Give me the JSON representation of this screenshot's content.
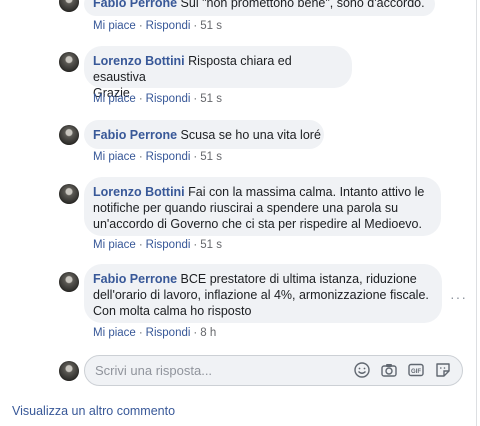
{
  "comments": [
    {
      "author": "Fabio Perrone",
      "text": "Sul \"non promettono bene\", sono d'accordo.",
      "like": "Mi piace",
      "reply": "Rispondi",
      "time": "51 s"
    },
    {
      "author": "Lorenzo Bottini",
      "text_line1": "Risposta chiara ed esaustiva",
      "text_line2": "Grazie",
      "like": "Mi piace",
      "reply": "Rispondi",
      "time": "51 s"
    },
    {
      "author": "Fabio Perrone",
      "text": "Scusa se ho una vita loré",
      "like": "Mi piace",
      "reply": "Rispondi",
      "time": "51 s"
    },
    {
      "author": "Lorenzo Bottini",
      "text_line1": "Fai con la massima calma. Intanto attivo le",
      "text_line2": "notifiche per quando riuscirai a spendere una parola su",
      "text_line3": "un'accordo di Governo che ci sta per rispedire al Medioevo.",
      "like": "Mi piace",
      "reply": "Rispondi",
      "time": "51 s"
    },
    {
      "author": "Fabio Perrone",
      "text_line1": "BCE prestatore di ultima istanza, riduzione",
      "text_line2": "dell'orario di lavoro, inflazione al 4%, armonizzazione fiscale.",
      "text_line3": "Con molta calma ho risposto",
      "like": "Mi piace",
      "reply": "Rispondi",
      "time": "8 h"
    }
  ],
  "reply_box": {
    "placeholder": "Scrivi una risposta..."
  },
  "more_options": "···",
  "view_more": "Visualizza un altro commento",
  "icons": [
    "emoji-icon",
    "camera-icon",
    "gif-icon",
    "sticker-icon"
  ],
  "colors": {
    "link": "#385898",
    "bubble": "#f0f2f5",
    "meta": "#65676b"
  }
}
